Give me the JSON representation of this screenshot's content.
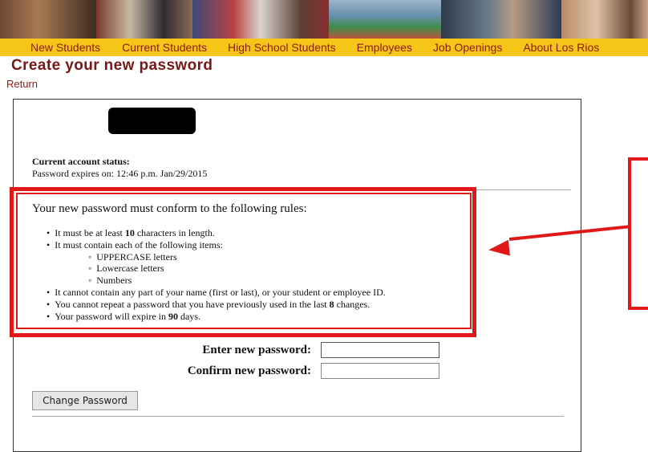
{
  "nav": {
    "items": [
      "New Students",
      "Current Students",
      "High School Students",
      "Employees",
      "Job Openings",
      "About Los Rios"
    ]
  },
  "page": {
    "title": "Create your new password",
    "return_label": "Return"
  },
  "status": {
    "heading": "Current account status:",
    "expires_text": "Password expires on: 12:46 p.m. Jan/29/2015"
  },
  "rules": {
    "heading": "Your new password must conform to the following rules:",
    "items": [
      {
        "prefix": "It must be at least ",
        "bold": "10",
        "suffix": " characters in length."
      },
      {
        "text": "It must contain each of the following items:"
      },
      {
        "text": "It cannot contain any part of your name (first or last), or your student or employee ID."
      },
      {
        "prefix": "You cannot repeat a password that you have previously used in the last ",
        "bold": "8",
        "suffix": " changes."
      },
      {
        "prefix": "Your password will expire in ",
        "bold": "90",
        "suffix": " days."
      }
    ],
    "sub_items": [
      "UPPERCASE letters",
      "Lowercase letters",
      "Numbers"
    ]
  },
  "form": {
    "new_password_label": "Enter new password:",
    "new_password_value": "",
    "confirm_password_label": "Confirm new password:",
    "confirm_password_value": "",
    "submit_label": "Change Password"
  },
  "colors": {
    "nav_background": "#f5c518",
    "brand_text": "#7a1616",
    "highlight": "#e01818"
  }
}
